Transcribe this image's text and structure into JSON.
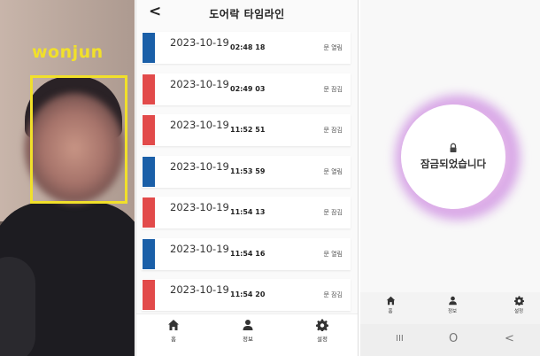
{
  "camera": {
    "detected_name": "wonjun",
    "box_color": "#f1e02a"
  },
  "timeline": {
    "title": "도어락 타임라인",
    "back_glyph": "<",
    "colors": {
      "open": "#1a5fa8",
      "lock": "#e24a4a"
    },
    "entries": [
      {
        "date": "2023-10-19",
        "time": "02:48 18",
        "status": "문 열림",
        "type": "open"
      },
      {
        "date": "2023-10-19",
        "time": "02:49 03",
        "status": "문 잠김",
        "type": "lock"
      },
      {
        "date": "2023-10-19",
        "time": "11:52 51",
        "status": "문 잠김",
        "type": "lock"
      },
      {
        "date": "2023-10-19",
        "time": "11:53 59",
        "status": "문 열림",
        "type": "open"
      },
      {
        "date": "2023-10-19",
        "time": "11:54 13",
        "status": "문 잠김",
        "type": "lock"
      },
      {
        "date": "2023-10-19",
        "time": "11:54 16",
        "status": "문 열림",
        "type": "open"
      },
      {
        "date": "2023-10-19",
        "time": "11:54 20",
        "status": "문 잠김",
        "type": "lock"
      }
    ],
    "nav": [
      {
        "label": "홈",
        "icon": "home-icon"
      },
      {
        "label": "정보",
        "icon": "person-icon"
      },
      {
        "label": "설정",
        "icon": "gear-icon"
      }
    ]
  },
  "lock_screen": {
    "message": "잠금되었습니다",
    "nav": [
      {
        "label": "홈",
        "icon": "home-icon"
      },
      {
        "label": "정보",
        "icon": "person-icon"
      },
      {
        "label": "설정",
        "icon": "gear-icon"
      }
    ],
    "system_nav": [
      {
        "glyph": "III",
        "icon": "recent-apps-icon"
      },
      {
        "glyph": "O",
        "icon": "home-circle-icon"
      },
      {
        "glyph": "<",
        "icon": "back-arrow-icon"
      }
    ]
  }
}
